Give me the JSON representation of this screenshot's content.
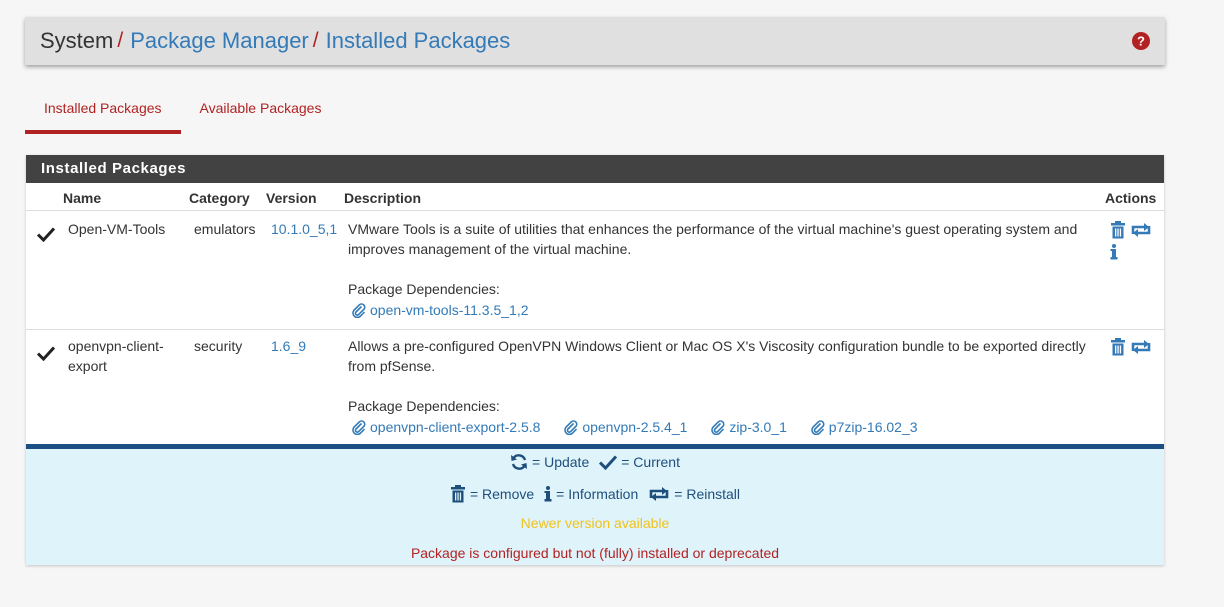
{
  "breadcrumb": {
    "root": "System",
    "sep": "/",
    "level2": "Package Manager",
    "level3": "Installed Packages"
  },
  "tabs": [
    {
      "label": "Installed Packages",
      "active": true
    },
    {
      "label": "Available Packages",
      "active": false
    }
  ],
  "panel": {
    "title": "Installed Packages",
    "columns": {
      "name": "Name",
      "category": "Category",
      "version": "Version",
      "description": "Description",
      "actions": "Actions"
    },
    "rows": [
      {
        "name": "Open-VM-Tools",
        "category": "emulators",
        "version": "10.1.0_5,1",
        "description": "VMware Tools is a suite of utilities that enhances the performance of the virtual machine's guest operating system and improves management of the virtual machine.",
        "deps_label": "Package Dependencies:",
        "deps": [
          "open-vm-tools-11.3.5_1,2"
        ]
      },
      {
        "name": "openvpn-client-export",
        "category": "security",
        "version": "1.6_9",
        "description": "Allows a pre-configured OpenVPN Windows Client or Mac OS X's Viscosity configuration bundle to be exported directly from pfSense.",
        "deps_label": "Package Dependencies:",
        "deps": [
          "openvpn-client-export-2.5.8",
          "openvpn-2.5.4_1",
          "zip-3.0_1",
          "p7zip-16.02_3"
        ]
      }
    ]
  },
  "legend": {
    "update": "= Update",
    "current": "= Current",
    "remove": "= Remove",
    "information": "= Information",
    "reinstall": "= Reinstall",
    "newer": "Newer version available",
    "warning": "Package is configured but not (fully) installed or deprecated"
  },
  "colors": {
    "accent_red": "#b22222",
    "link_blue": "#337ab7",
    "heading_dark": "#424242",
    "legend_bg": "#dff3fb",
    "newer_yellow": "#f0c21a"
  },
  "icons": [
    "help-icon",
    "check-icon",
    "trash-icon",
    "reinstall-icon",
    "info-icon",
    "paperclip-icon",
    "update-icon"
  ]
}
